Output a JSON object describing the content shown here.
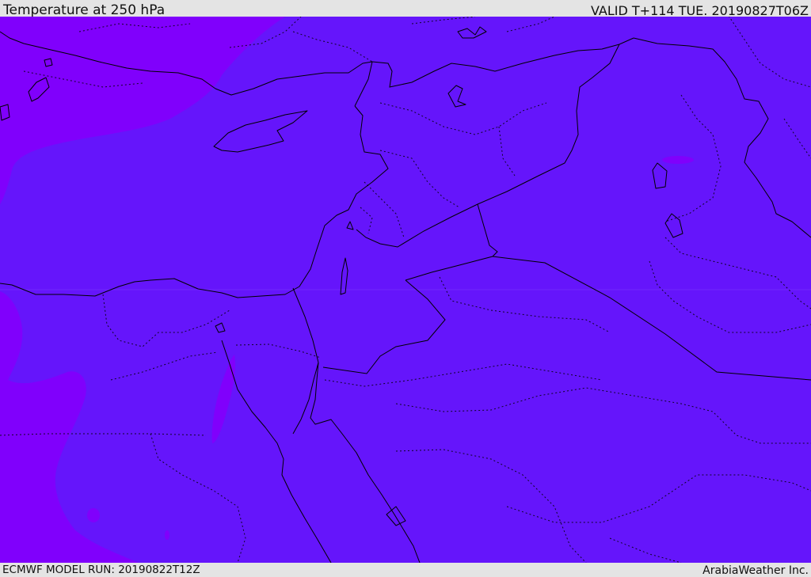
{
  "header": {
    "title": "Temperature at 250 hPa",
    "valid": "VALID T+114 TUE. 20190827T06Z"
  },
  "footer": {
    "model_run": "ECMWF MODEL RUN: 20190822T12Z",
    "credit": "ArabiaWeather Inc."
  },
  "map": {
    "region": "Eastern Mediterranean / Middle East",
    "colors": {
      "main_fill": "#6515fb",
      "cold_fill": "#8000fc",
      "coastline": "#000000",
      "boundary": "#000000"
    }
  }
}
